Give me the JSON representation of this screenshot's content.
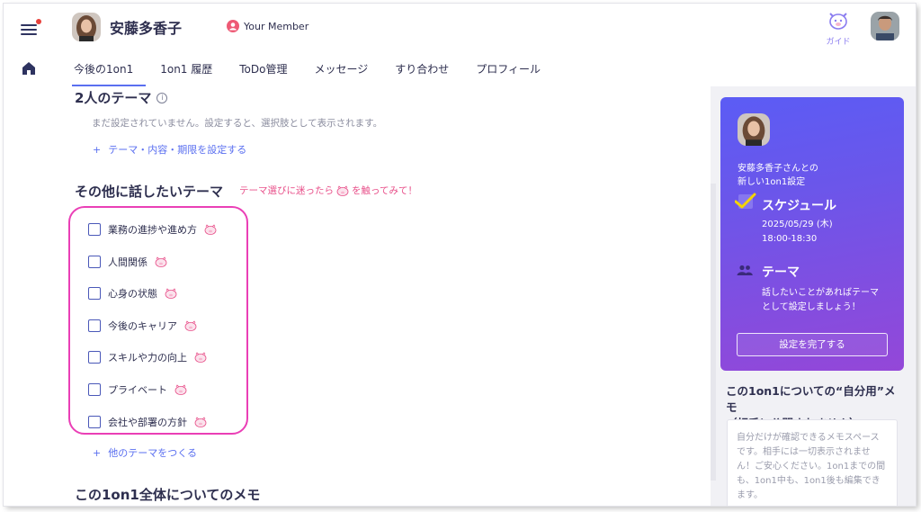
{
  "header": {
    "user_name": "安藤多香子",
    "member_label": "Your Member",
    "guide_label": "ガイド"
  },
  "tabs": [
    {
      "label": "今後の1on1",
      "active": true
    },
    {
      "label": "1on1 履歴"
    },
    {
      "label": "ToDo管理"
    },
    {
      "label": "メッセージ"
    },
    {
      "label": "すり合わせ"
    },
    {
      "label": "プロフィール"
    }
  ],
  "shared_theme": {
    "title": "2人のテーマ",
    "empty_text": "まだ設定されていません。設定すると、選択肢として表示されます。",
    "add_label": "テーマ・内容・期限を設定する"
  },
  "other_themes": {
    "title": "その他に話したいテーマ",
    "hint_before": "テーマ選びに迷ったら",
    "hint_after": "を触ってみて！",
    "items": [
      {
        "label": "業務の進捗や進め方",
        "checked": false
      },
      {
        "label": "人間関係",
        "checked": false
      },
      {
        "label": "心身の状態",
        "checked": false
      },
      {
        "label": "今後のキャリア",
        "checked": false
      },
      {
        "label": "スキルや力の向上",
        "checked": false
      },
      {
        "label": "プライベート",
        "checked": false
      },
      {
        "label": "会社や部署の方針",
        "checked": false
      }
    ],
    "add_label": "他のテーマをつくる"
  },
  "memo": {
    "title": "この1on1全体についてのメモ"
  },
  "card": {
    "title_line1": "安藤多香子さんとの",
    "title_line2": "新しい1on1設定",
    "schedule_title": "スケジュール",
    "schedule_date": "2025/05/29 (木)",
    "schedule_time": "18:00-18:30",
    "theme_title": "テーマ",
    "theme_desc_line1": "話したいことがあればテーマ",
    "theme_desc_line2": "として設定しましょう！",
    "done_button": "設定を完了する"
  },
  "self_memo": {
    "title_line1": "この1on1についての“自分用”メモ",
    "title_line2": "（相手に公開されません）",
    "placeholder": "自分だけが確認できるメモスペースです。相手には一切表示されません！ご安心ください。1on1までの間も、1on1中も、1on1後も編集できます。"
  },
  "colors": {
    "accent": "#5a6ff0",
    "highlight_border": "#ea3fb6",
    "hint_pink": "#e8508a",
    "card_gradient_start": "#5b5cf5",
    "card_gradient_end": "#9447d8"
  },
  "icons": [
    "menu-icon",
    "home-icon",
    "member-icon",
    "guide-icon",
    "info-icon",
    "pig-icon",
    "check-icon",
    "people-icon"
  ]
}
